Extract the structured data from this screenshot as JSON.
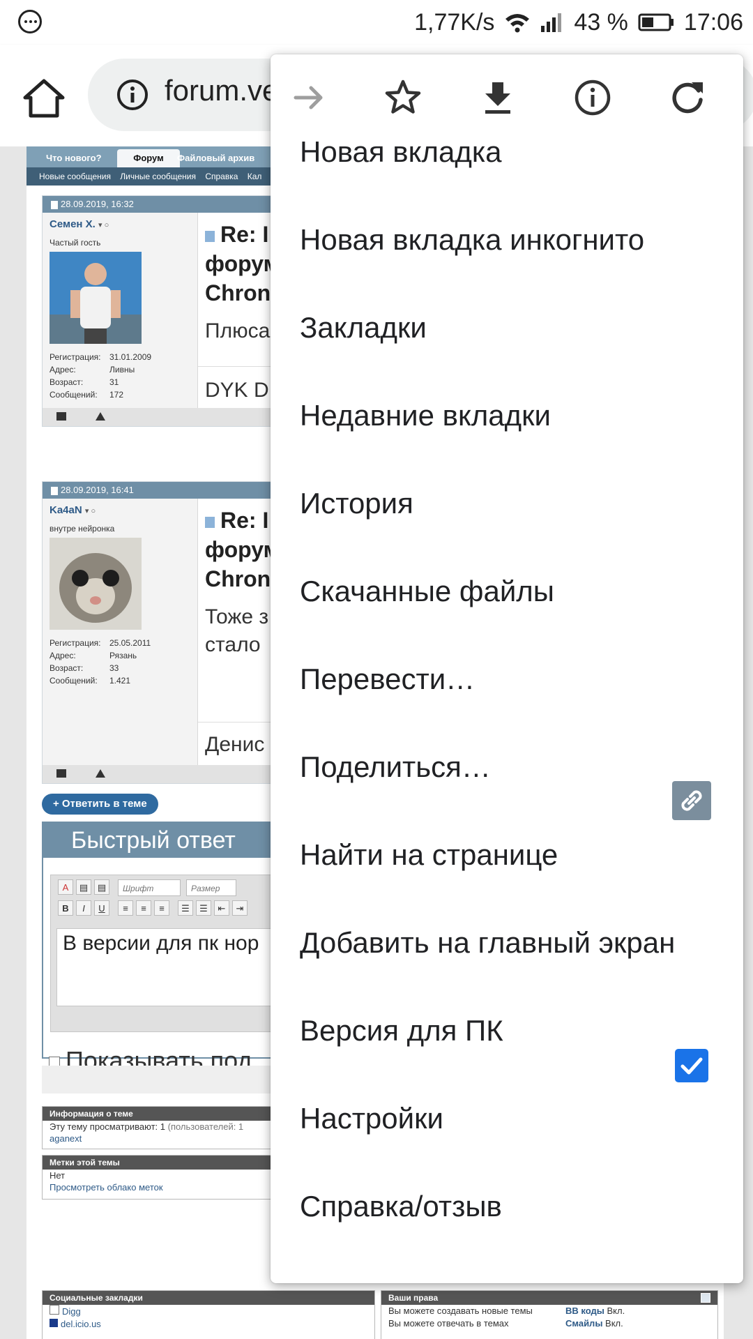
{
  "status_bar": {
    "speed": "1,77K/s",
    "battery": "43 %",
    "time": "17:06"
  },
  "toolbar": {
    "url": "forum.ve",
    "icons": [
      "home-icon",
      "info-icon"
    ]
  },
  "forum": {
    "nav_tabs": [
      "Что нового?",
      "Форум",
      "Файловый архив"
    ],
    "sub_nav": [
      "Новые сообщения",
      "Личные сообщения",
      "Справка",
      "Кал"
    ],
    "posts": [
      {
        "date": "28.09.2019, 16:32",
        "username": "Семен Х.",
        "user_title": "Частый гость",
        "stats": [
          {
            "label": "Регистрация:",
            "value": "31.01.2009"
          },
          {
            "label": "Адрес:",
            "value": "Ливны"
          },
          {
            "label": "Возраст:",
            "value": "31"
          },
          {
            "label": "Сообщений:",
            "value": "172"
          }
        ],
        "title_lines": [
          "Re: I",
          "форум",
          "Chron"
        ],
        "body": "Плюса",
        "signature": "DYK D."
      },
      {
        "date": "28.09.2019, 16:41",
        "username": "Ka4aN",
        "user_title": "внутре нейронка",
        "stats": [
          {
            "label": "Регистрация:",
            "value": "25.05.2011"
          },
          {
            "label": "Адрес:",
            "value": "Рязань"
          },
          {
            "label": "Возраст:",
            "value": "33"
          },
          {
            "label": "Сообщений:",
            "value": "1.421"
          }
        ],
        "title_lines": [
          "Re: I",
          "форум",
          "Chron"
        ],
        "body_lines": [
          "Тоже з",
          "стало"
        ],
        "signature": "Денис"
      }
    ],
    "reply_button": "+ Ответить в теме",
    "quick_reply": {
      "title": "Быстрый ответ",
      "font_select": "Шрифт",
      "size_select": "Размер",
      "text": "В версии для пк нор",
      "show_signature": "Показывать под"
    },
    "topic_info": {
      "header": "Информация о теме",
      "line": "Эту тему просматривают: 1",
      "line_muted": "(пользователей: 1",
      "user": "aganext"
    },
    "tags": {
      "header": "Метки этой темы",
      "none": "Нет",
      "link": "Просмотреть облако меток"
    },
    "social": {
      "header": "Социальные закладки",
      "items": [
        "Digg",
        "del.icio.us"
      ]
    },
    "rights": {
      "header": "Ваши права",
      "rows": [
        {
          "text": "Вы можете создавать новые темы",
          "key": "BB коды",
          "val": "Вкл."
        },
        {
          "text": "Вы можете отвечать в темах",
          "key": "Смайлы",
          "val": "Вкл."
        }
      ]
    }
  },
  "menu": {
    "top_icons": [
      "forward-icon",
      "bookmark-star-icon",
      "download-icon",
      "info-icon",
      "reload-icon"
    ],
    "items": [
      "Новая вкладка",
      "Новая вкладка инкогнито",
      "Закладки",
      "Недавние вкладки",
      "История",
      "Скачанные файлы",
      "Перевести…",
      "Поделиться…",
      "Найти на странице",
      "Добавить на главный экран",
      "Версия для ПК",
      "Настройки",
      "Справка/отзыв"
    ],
    "desktop_version_checked": true,
    "colors": {
      "check": "#1a73e8",
      "share_icon": "#7b8e9d"
    }
  }
}
